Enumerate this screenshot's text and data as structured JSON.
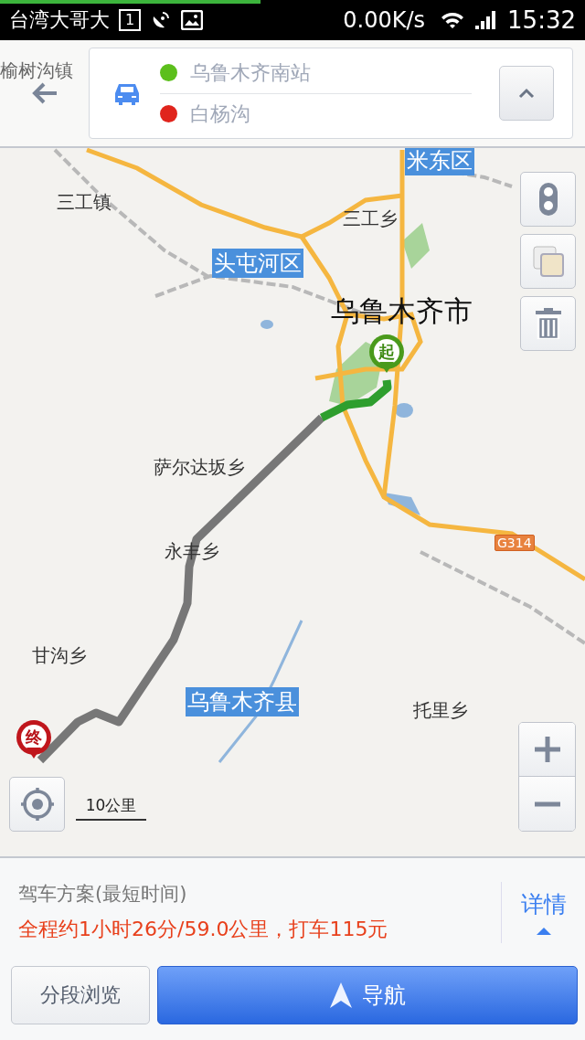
{
  "status_bar": {
    "carrier": "台湾大哥大",
    "sim": "1",
    "speed": "0.00K/s",
    "time": "15:32"
  },
  "route": {
    "from": "乌鲁木齐南站",
    "to": "白杨沟"
  },
  "map": {
    "labels": [
      {
        "text": "榆树沟镇",
        "kind": "faded"
      },
      {
        "text": "米东区",
        "kind": "district"
      },
      {
        "text": "三工镇",
        "kind": "place"
      },
      {
        "text": "三工乡",
        "kind": "place"
      },
      {
        "text": "头屯河区",
        "kind": "district"
      },
      {
        "text": "乌鲁木齐市",
        "kind": "city"
      },
      {
        "text": "萨尔达坂乡",
        "kind": "place"
      },
      {
        "text": "永丰乡",
        "kind": "place"
      },
      {
        "text": "G314",
        "kind": "road"
      },
      {
        "text": "甘沟乡",
        "kind": "place"
      },
      {
        "text": "乌鲁木齐县",
        "kind": "district"
      },
      {
        "text": "托里乡",
        "kind": "place"
      }
    ],
    "start_marker": "起",
    "end_marker": "终",
    "scale": "10公里"
  },
  "summary": {
    "title": "驾车方案(最短时间)",
    "detail": "全程约1小时26分/59.0公里，打车115元",
    "details_link": "详情"
  },
  "buttons": {
    "segments": "分段浏览",
    "navigate": "导航"
  }
}
